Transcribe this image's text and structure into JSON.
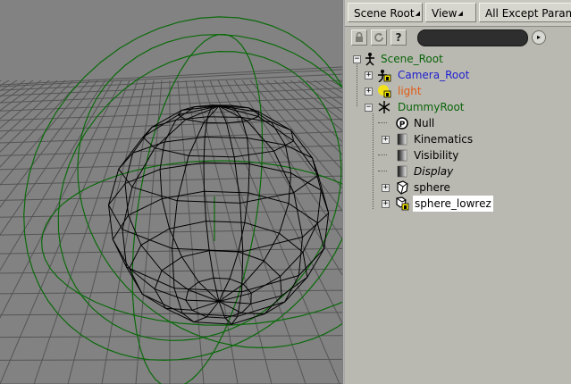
{
  "toolbar": {
    "scene_root_label": "Scene Root",
    "view_label": "View",
    "filter_label": "All Except Params"
  },
  "iconbar": {
    "icons": [
      "lock-icon",
      "refresh-icon",
      "help-icon"
    ],
    "help_glyph": "?"
  },
  "tree": {
    "scene_root": "Scene_Root",
    "camera_root": "Camera_Root",
    "light": "light",
    "dummy_root": "DummyRoot",
    "null": "Null",
    "kinematics": "Kinematics",
    "visibility": "Visibility",
    "display": "Display",
    "sphere": "sphere",
    "sphere_lowrez": "sphere_lowrez"
  },
  "colors": {
    "viewport_bg": "#828282",
    "grid": "#555555",
    "wire_black": "#000000",
    "wire_green": "#0a6a0a",
    "scene_root_text": "#0a640a",
    "camera_text": "#1f1fd0",
    "light_text": "#e25a14",
    "dummy_text": "#0a640a"
  }
}
